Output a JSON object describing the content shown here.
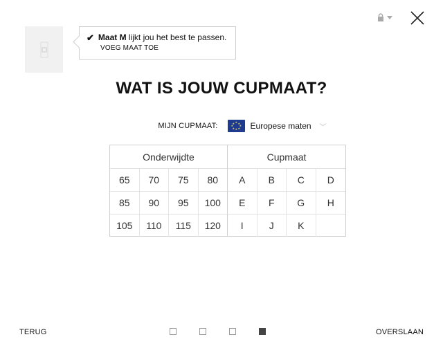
{
  "header": {
    "lock_icon": "lock-icon",
    "close_icon": "close-icon"
  },
  "recommendation": {
    "size_bold": "Maat M",
    "size_text": " lijkt jou het best te passen.",
    "add_size": "VOEG MAAT TOE"
  },
  "title": "WAT IS JOUW CUPMAAT?",
  "size_system": {
    "label": "MIJN CUPMAAT:",
    "value": "Europese maten"
  },
  "grid": {
    "band_header": "Onderwijdte",
    "cup_header": "Cupmaat",
    "rows": [
      [
        "65",
        "70",
        "75",
        "80",
        "A",
        "B",
        "C",
        "D"
      ],
      [
        "85",
        "90",
        "95",
        "100",
        "E",
        "F",
        "G",
        "H"
      ],
      [
        "105",
        "110",
        "115",
        "120",
        "I",
        "J",
        "K",
        ""
      ]
    ]
  },
  "footer": {
    "back": "TERUG",
    "skip": "OVERSLAAN",
    "steps_total": 4,
    "current_step": 4
  },
  "colors": {
    "border": "#cfcfcf",
    "flag_blue": "#1e3b8f",
    "active_step": "#444444"
  }
}
